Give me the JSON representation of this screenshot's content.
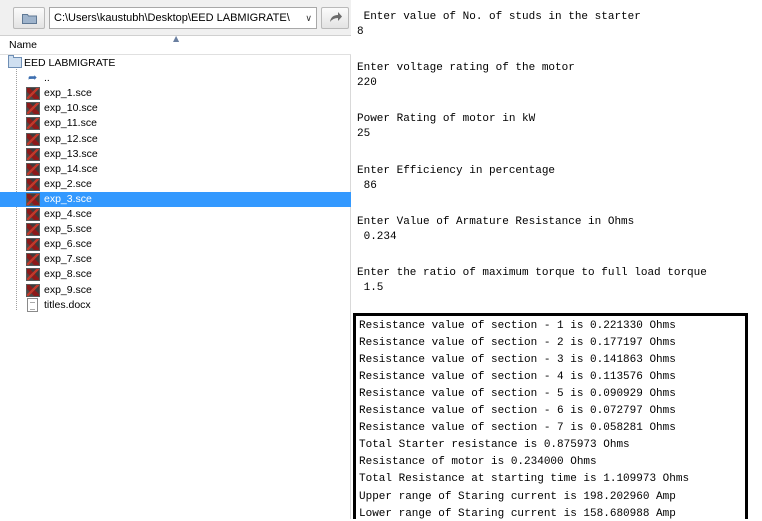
{
  "file_browser": {
    "path": "C:\\Users\\kaustubh\\Desktop\\EED LABMIGRATE\\",
    "column_header": "Name",
    "root_folder": "EED LABMIGRATE",
    "parent_label": "..",
    "files": [
      "exp_1.sce",
      "exp_10.sce",
      "exp_11.sce",
      "exp_12.sce",
      "exp_13.sce",
      "exp_14.sce",
      "exp_2.sce",
      "exp_3.sce",
      "exp_4.sce",
      "exp_5.sce",
      "exp_6.sce",
      "exp_7.sce",
      "exp_8.sce",
      "exp_9.sce",
      "titles.docx"
    ],
    "selected": "exp_3.sce",
    "selection_color": "#3399ff"
  },
  "console": {
    "prompts": [
      {
        "prompt": " Enter value of No. of studs in the starter",
        "value": "8"
      },
      {
        "prompt": "Enter voltage rating of the motor",
        "value": "220"
      },
      {
        "prompt": "Power Rating of motor in kW",
        "value": "25"
      },
      {
        "prompt": "Enter Efficiency in percentage",
        "value": " 86"
      },
      {
        "prompt": "Enter Value of Armature Resistance in Ohms",
        "value": " 0.234"
      },
      {
        "prompt": "Enter the ratio of maximum torque to full load torque",
        "value": " 1.5"
      }
    ],
    "results": [
      "Resistance value of section - 1 is 0.221330 Ohms",
      "Resistance value of section - 2 is 0.177197 Ohms",
      "Resistance value of section - 3 is 0.141863 Ohms",
      "Resistance value of section - 4 is 0.113576 Ohms",
      "Resistance value of section - 5 is 0.090929 Ohms",
      "Resistance value of section - 6 is 0.072797 Ohms",
      "Resistance value of section - 7 is 0.058281 Ohms",
      "Total Starter resistance is 0.875973 Ohms",
      "Resistance of motor is 0.234000 Ohms",
      "Total Resistance at starting time is 1.109973 Ohms",
      "Upper range of Staring current is 198.202960 Amp",
      "Lower range of Staring current is 158.680988 Amp"
    ]
  }
}
